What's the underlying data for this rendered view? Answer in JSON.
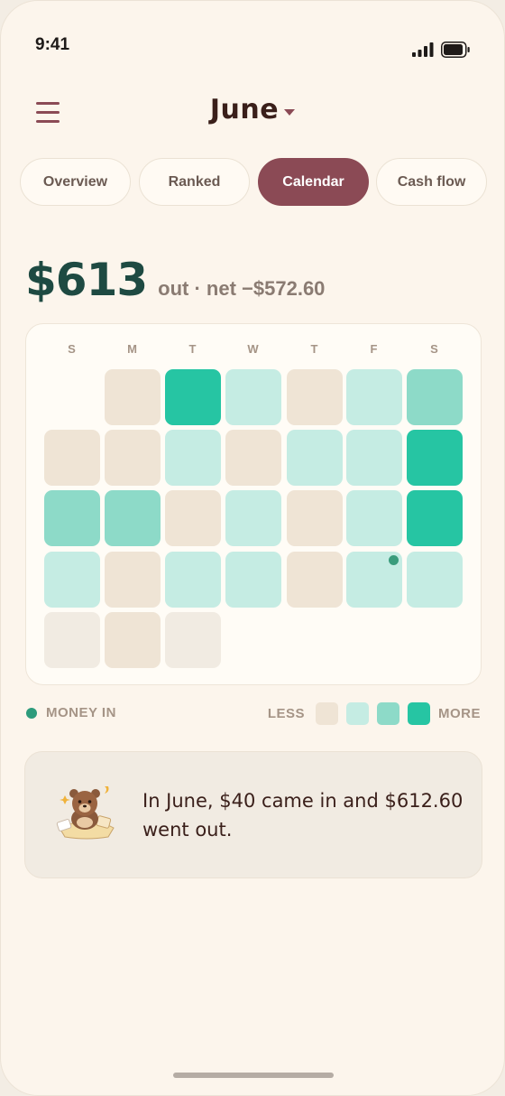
{
  "status_bar": {
    "time": "9:41"
  },
  "header": {
    "month": "June"
  },
  "tabs": [
    {
      "label": "Overview",
      "active": false
    },
    {
      "label": "Ranked",
      "active": false
    },
    {
      "label": "Calendar",
      "active": true
    },
    {
      "label": "Cash flow",
      "active": false
    }
  ],
  "summary": {
    "amount": "$613",
    "detail": "out · net −$572.60"
  },
  "calendar": {
    "weekdays": [
      "S",
      "M",
      "T",
      "W",
      "T",
      "F",
      "S"
    ],
    "weeks": [
      [
        "empty",
        "none",
        "high",
        "low",
        "none",
        "low",
        "mid"
      ],
      [
        "none",
        "none",
        "low",
        "none",
        "low",
        "low",
        "high"
      ],
      [
        "mid",
        "mid",
        "none",
        "low",
        "none",
        "low",
        "high"
      ],
      [
        "low",
        "none",
        "low",
        "low",
        "none",
        "low-money-in",
        "low"
      ],
      [
        "future",
        "none",
        "future",
        "empty",
        "empty",
        "empty",
        "empty"
      ]
    ]
  },
  "legend": {
    "money_in": "MONEY IN",
    "less": "LESS",
    "more": "MORE",
    "colors": {
      "none": "#efe4d5",
      "low": "#c5ece3",
      "mid": "#8ddac8",
      "high": "#26c5a3",
      "money_in_dot": "#2d9b7c"
    }
  },
  "insight": {
    "text": "In June, $40 came in and $612.60 went out."
  }
}
